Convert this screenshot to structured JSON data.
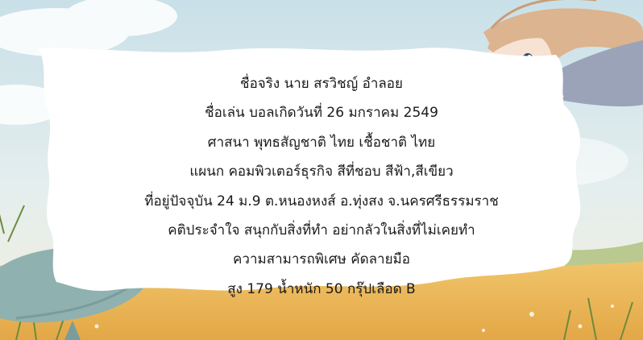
{
  "profile": {
    "lines": [
      "ชื่อจริง นาย สรวิชญ์ อำลอย",
      "ชื่อเล่น บอลเกิดวันที่ 26 มกราคม 2549",
      "ศาสนา พุทธสัญชาติ ไทย  เชื้อชาติ ไทย",
      "แผนก คอมพิวเตอร์ธุรกิจ  สีที่ชอบ สีฟ้า,สีเขียว",
      "ที่อยู่ปัจจุบัน 24 ม.9 ต.หนองหงส์ อ.ทุ่งสง จ.นครศรีธรรมราช",
      "คติประจำใจ สนุกกับสิ่งที่ทำ อย่ากลัวในสิ่งที่ไม่เคยทำ",
      "ความสามารถพิเศษ คัดลายมือ",
      "สูง 179 น้ำหนัก 50 กรุ๊ปเลือด B"
    ]
  },
  "colors": {
    "sky": "#cfe3ea",
    "field": "#e9b256",
    "paper": "#ffffff",
    "whale": "#8fb1b0",
    "hair": "#dcb48f",
    "text": "#1a1a1a"
  }
}
